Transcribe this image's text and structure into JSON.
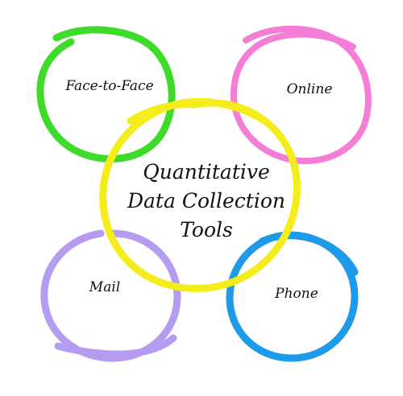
{
  "center": {
    "lines": [
      "Quantitative",
      "Data Collection",
      "Tools"
    ],
    "color": "#f5ec1c"
  },
  "nodes": [
    {
      "id": "face-to-face",
      "label": "Face-to-Face",
      "color": "#3fdb2a"
    },
    {
      "id": "online",
      "label": "Online",
      "color": "#f47ed6"
    },
    {
      "id": "mail",
      "label": "Mail",
      "color": "#b59cf0"
    },
    {
      "id": "phone",
      "label": "Phone",
      "color": "#1e9be8"
    }
  ]
}
